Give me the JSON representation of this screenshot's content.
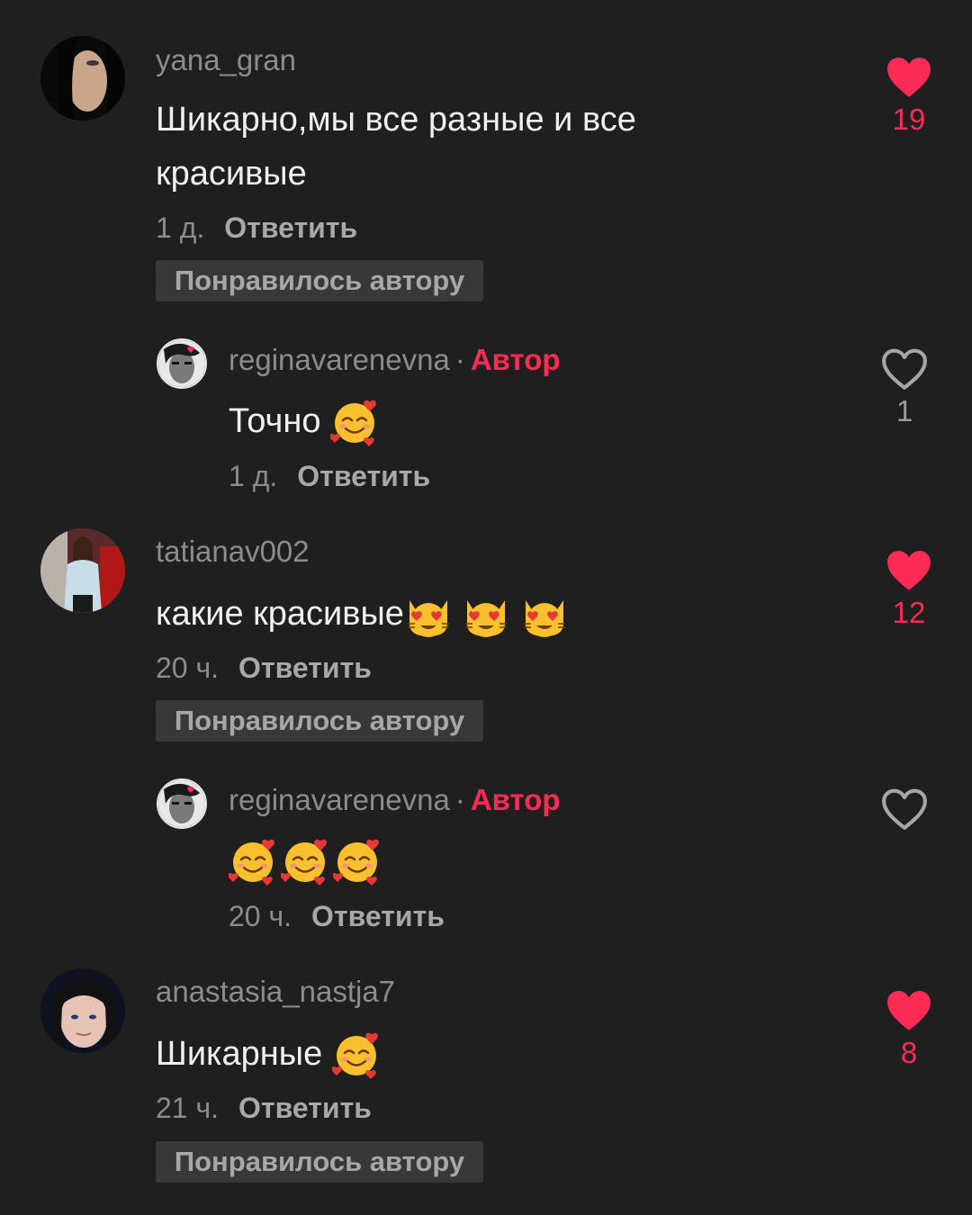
{
  "comments": [
    {
      "username": "yana_gran",
      "text": "Шикарно,мы все разные и все красивые",
      "time": "1 д.",
      "reply_label": "Ответить",
      "liked_by_author": "Понравилось автору",
      "likes": "19",
      "liked": true,
      "replies": [
        {
          "username": "reginavarenevna",
          "author_label": "Автор",
          "text": "Точно",
          "emoji": [
            "smiling-face-with-hearts"
          ],
          "time": "1 д.",
          "reply_label": "Ответить",
          "likes": "1",
          "liked": false
        }
      ]
    },
    {
      "username": "tatianav002",
      "text": "какие красивые",
      "emoji": [
        "heart-eyes-cat",
        "heart-eyes-cat",
        "heart-eyes-cat"
      ],
      "time": "20 ч.",
      "reply_label": "Ответить",
      "liked_by_author": "Понравилось автору",
      "likes": "12",
      "liked": true,
      "replies": [
        {
          "username": "reginavarenevna",
          "author_label": "Автор",
          "text": "",
          "emoji": [
            "smiling-face-with-hearts",
            "smiling-face-with-hearts",
            "smiling-face-with-hearts"
          ],
          "time": "20 ч.",
          "reply_label": "Ответить",
          "likes": "",
          "liked": false
        }
      ]
    },
    {
      "username": "anastasia_nastja7",
      "text": "Шикарные",
      "emoji": [
        "smiling-face-with-hearts"
      ],
      "time": "21 ч.",
      "reply_label": "Ответить",
      "liked_by_author": "Понравилось автору",
      "likes": "8",
      "liked": true
    }
  ],
  "colors": {
    "background": "#1f1f1f",
    "accent": "#fe2c55",
    "muted": "#8c8c8c",
    "badge": "#383838"
  }
}
